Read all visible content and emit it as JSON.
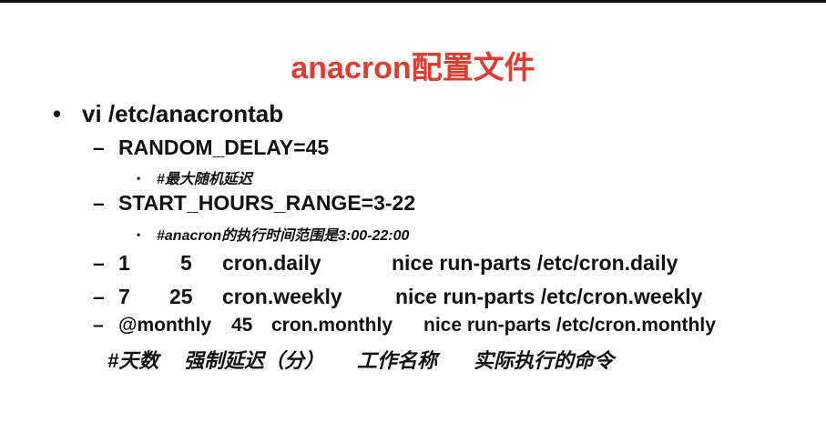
{
  "title": "anacron配置文件",
  "bullet_main": "vi /etc/anacrontab",
  "items": {
    "random_delay": "RANDOM_DELAY=45",
    "random_delay_note": "#最大随机延迟",
    "start_hours": "START_HOURS_RANGE=3-22",
    "start_hours_note": "#anacron的执行时间范围是3:00-22:00",
    "daily": {
      "period": "1",
      "delay": "5",
      "name": "cron.daily",
      "command": "nice run-parts /etc/cron.daily"
    },
    "weekly": {
      "period": "7",
      "delay": "25",
      "name": "cron.weekly",
      "command": "nice run-parts /etc/cron.weekly"
    },
    "monthly": {
      "period": "@monthly",
      "delay": "45",
      "name": "cron.monthly",
      "command": "nice run-parts /etc/cron.monthly"
    }
  },
  "legend": {
    "days": "#天数",
    "delay": "强制延迟（分）",
    "job": "工作名称",
    "command": "实际执行的命令"
  }
}
